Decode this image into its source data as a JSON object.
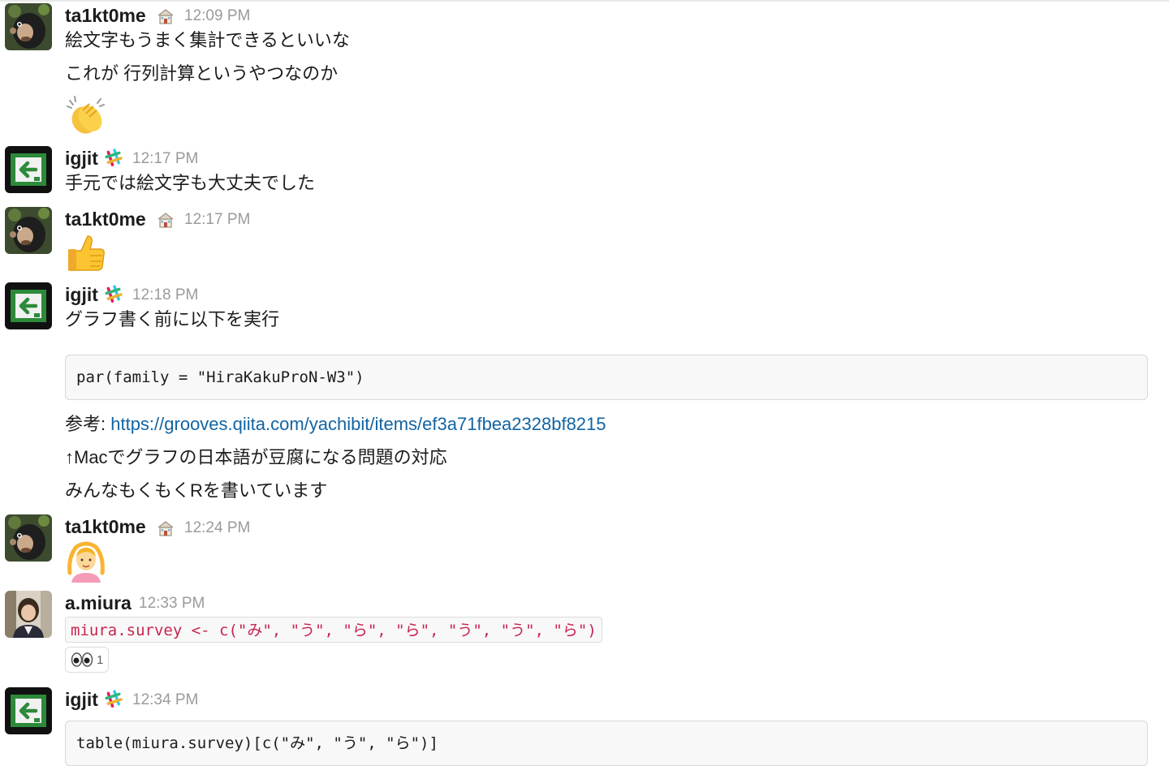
{
  "colors": {
    "link": "#1264a3",
    "code_text": "#c7254e",
    "timestamp": "#9b9b9b"
  },
  "messages": [
    {
      "author": "ta1kt0me",
      "badge": "house-icon",
      "time": "12:09 PM",
      "lines": [
        "絵文字もうまく集計できるといいな",
        "これが 行列計算というやつなのか"
      ],
      "emoji": "clapping-hands-icon"
    },
    {
      "author": "igjit",
      "badge": "slack-icon",
      "time": "12:17 PM",
      "lines": [
        "手元では絵文字も大丈夫でした"
      ]
    },
    {
      "author": "ta1kt0me",
      "badge": "house-icon",
      "time": "12:17 PM",
      "emoji": "thumbs-up-icon"
    },
    {
      "author": "igjit",
      "badge": "slack-icon",
      "time": "12:18 PM",
      "lines": [
        "グラフ書く前に以下を実行"
      ],
      "code": "par(family = \"HiraKakuProN-W3\")",
      "ref_prefix": "参考: ",
      "ref_link": "https://grooves.qiita.com/yachibit/items/ef3a71fbea2328bf8215",
      "after_lines": [
        "↑Macでグラフの日本語が豆腐になる問題の対応",
        "みんなもくもくRを書いています"
      ]
    },
    {
      "author": "ta1kt0me",
      "badge": "house-icon",
      "time": "12:24 PM",
      "emoji": "ok-gesture-woman-icon"
    },
    {
      "author": "a.miura",
      "time": "12:33 PM",
      "inline_code": "miura.survey <- c(\"み\", \"う\", \"ら\", \"ら\", \"う\", \"う\", \"ら\")",
      "reaction": {
        "icon": "eyes-icon",
        "count": "1"
      }
    },
    {
      "author": "igjit",
      "badge": "slack-icon",
      "time": "12:34 PM",
      "code": "table(miura.survey)[c(\"み\", \"う\", \"ら\")]"
    }
  ]
}
